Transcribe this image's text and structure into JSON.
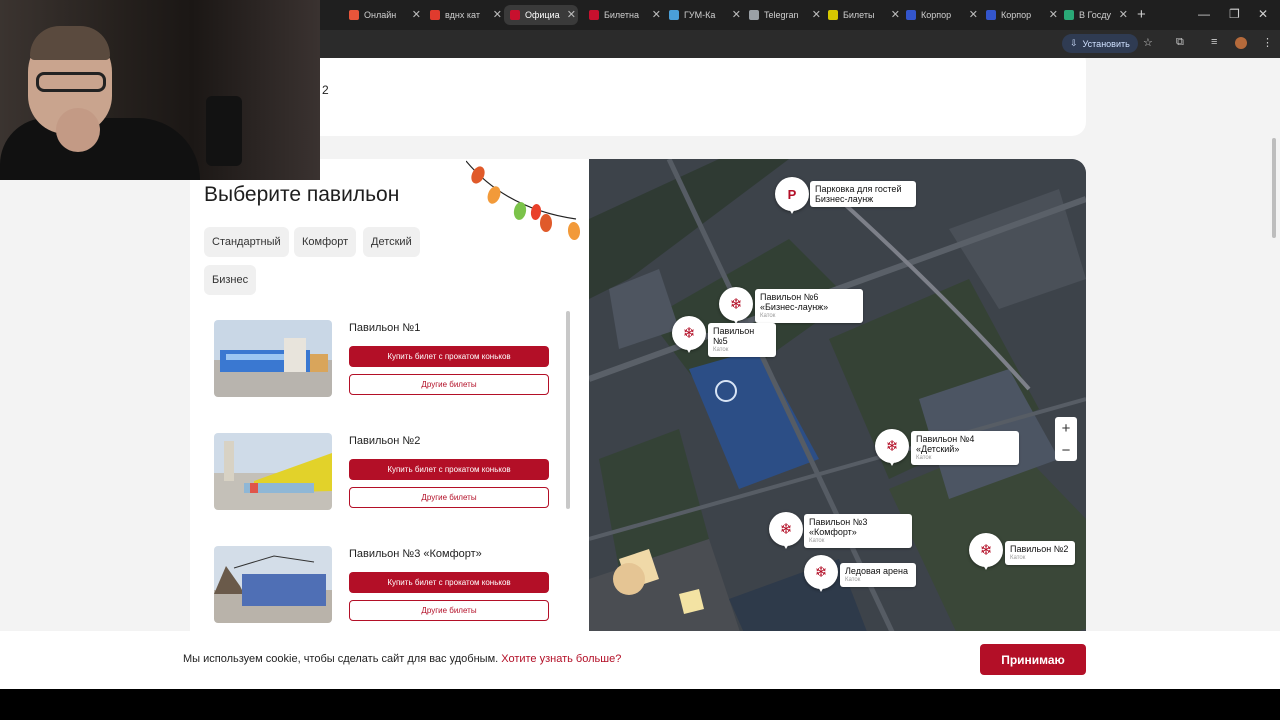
{
  "browser": {
    "tabs": [
      {
        "label": "Онлайн",
        "color": "#e8553a"
      },
      {
        "label": "вднх кат",
        "color": "#e03b2e"
      },
      {
        "label": "Официа",
        "color": "#c8102e",
        "active": true
      },
      {
        "label": "Билетна",
        "color": "#c8102e"
      },
      {
        "label": "ГУМ-Ка",
        "color": "#4a9fd8"
      },
      {
        "label": "Telegran",
        "color": "#9aa0a6"
      },
      {
        "label": "Билеты",
        "color": "#d6c800"
      },
      {
        "label": "Корпор",
        "color": "#3355cc"
      },
      {
        "label": "Корпор",
        "color": "#3355cc"
      },
      {
        "label": "В Госду",
        "color": "#2aa876"
      }
    ],
    "install_label": "Установить"
  },
  "prev": {
    "text": "2"
  },
  "section": {
    "title": "Выберите павильон",
    "filters": [
      "Стандартный",
      "Комфорт",
      "Детский",
      "Бизнес"
    ]
  },
  "pavilions": [
    {
      "name": "Павильон №1",
      "buy": "Купить билет с прокатом коньков",
      "other": "Другие билеты"
    },
    {
      "name": "Павильон №2",
      "buy": "Купить билет с прокатом коньков",
      "other": "Другие билеты"
    },
    {
      "name": "Павильон №3 «Комфорт»",
      "buy": "Купить билет с прокатом коньков",
      "other": "Другие билеты"
    }
  ],
  "map": {
    "parking": {
      "letter": "P",
      "line1": "Парковка для гостей",
      "line2": "Бизнес-лаунж"
    },
    "markers": [
      {
        "line1": "Павильон №6",
        "line2": "«Бизнес-лаунж»",
        "sub": "Каток"
      },
      {
        "line1": "Павильон №5",
        "line2": "",
        "sub": "Каток"
      },
      {
        "line1": "Павильон №4",
        "line2": "«Детский»",
        "sub": "Каток"
      },
      {
        "line1": "Павильон №3",
        "line2": "«Комфорт»",
        "sub": "Каток"
      },
      {
        "line1": "Павильон №2",
        "line2": "",
        "sub": "Каток"
      },
      {
        "line1": "Ледовая арена",
        "line2": "",
        "sub": "Каток"
      }
    ],
    "zoom_in": "+",
    "zoom_out": "−"
  },
  "cookie": {
    "text": "Мы используем cookie, чтобы сделать сайт для вас удобным.",
    "link": "Хотите узнать больше?",
    "accept": "Принимаю"
  },
  "colors": {
    "brand": "#b30f27"
  }
}
